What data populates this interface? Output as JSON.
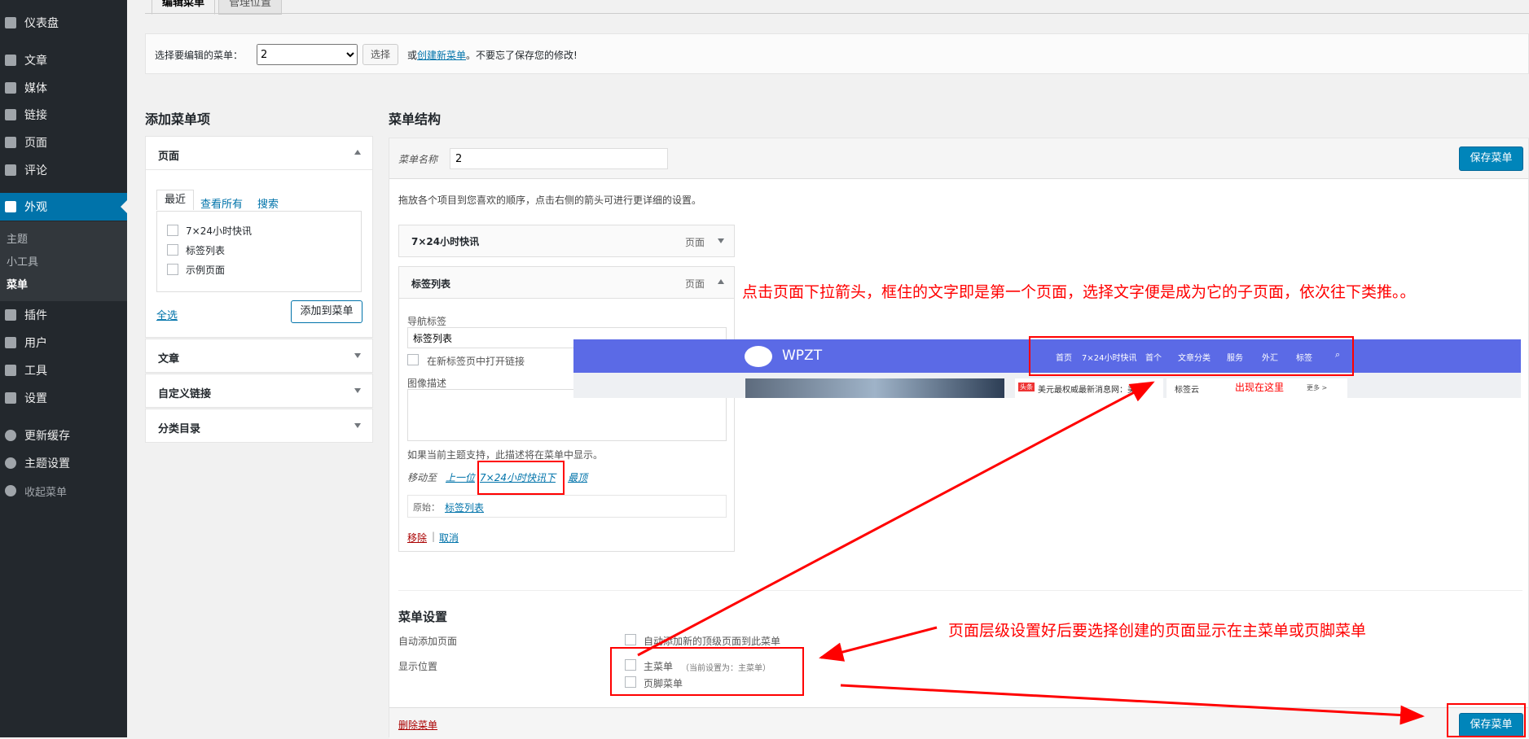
{
  "sidebar": {
    "items": [
      {
        "label": "仪表盘",
        "icon": "dashboard-icon"
      },
      {
        "label": "文章",
        "icon": "pin-icon"
      },
      {
        "label": "媒体",
        "icon": "media-icon"
      },
      {
        "label": "链接",
        "icon": "link-icon"
      },
      {
        "label": "页面",
        "icon": "page-icon"
      },
      {
        "label": "评论",
        "icon": "comment-icon"
      },
      {
        "label": "外观",
        "icon": "brush-icon"
      },
      {
        "label": "插件",
        "icon": "plugin-icon"
      },
      {
        "label": "用户",
        "icon": "user-icon"
      },
      {
        "label": "工具",
        "icon": "wrench-icon"
      },
      {
        "label": "设置",
        "icon": "settings-icon"
      },
      {
        "label": "更新缓存",
        "icon": "gear-icon"
      },
      {
        "label": "主题设置",
        "icon": "gear-icon"
      },
      {
        "label": "收起菜单",
        "icon": "collapse-icon"
      }
    ],
    "submenu": [
      "主题",
      "小工具",
      "菜单"
    ]
  },
  "tabs": {
    "edit": "编辑菜单",
    "manage": "管理位置"
  },
  "manage": {
    "select_label": "选择要编辑的菜单：",
    "select_value": "2",
    "select_button": "选择",
    "or_text": "或",
    "create_link": "创建新菜单",
    "reminder": "。不要忘了保存您的修改!"
  },
  "add_items": {
    "title": "添加菜单项",
    "pages_header": "页面",
    "tabs": [
      "最近",
      "查看所有",
      "搜索"
    ],
    "pages": [
      "7×24小时快讯",
      "标签列表",
      "示例页面"
    ],
    "select_all": "全选",
    "add_button": "添加到菜单",
    "sections": [
      "文章",
      "自定义链接",
      "分类目录"
    ]
  },
  "structure": {
    "title": "菜单结构",
    "name_label": "菜单名称",
    "name_value": "2",
    "save_button": "保存菜单",
    "instructions": "拖放各个项目到您喜欢的顺序，点击右侧的箭头可进行更详细的设置。",
    "items": [
      {
        "title": "7×24小时快讯",
        "type": "页面"
      },
      {
        "title": "标签列表",
        "type": "页面"
      }
    ],
    "edit": {
      "nav_label": "导航标签",
      "nav_value": "标签列表",
      "new_tab": "在新标签页中打开链接",
      "desc_label": "图像描述",
      "desc_hint": "如果当前主题支持，此描述将在菜单中显示。",
      "move_label": "移动至",
      "move_up": "上一位",
      "move_under": "7×24小时快讯下",
      "move_top": "最顶",
      "original_label": "原始：",
      "original_link": "标签列表",
      "remove": "移除",
      "sep": "|",
      "cancel": "取消"
    }
  },
  "settings": {
    "title": "菜单设置",
    "auto_label": "自动添加页面",
    "auto_option": "自动添加新的顶级页面到此菜单",
    "location_label": "显示位置",
    "main_menu": "主菜单",
    "main_menu_note": "（当前设置为：主菜单）",
    "footer_menu": "页脚菜单",
    "delete": "删除菜单",
    "save": "保存菜单"
  },
  "annotations": {
    "note1": "点击页面下拉箭头，框住的文字即是第一个页面，选择文字便是成为它的子页面，依次往下类推。。",
    "note2": "页面层级设置好后要选择创建的页面显示在主菜单或页脚菜单"
  },
  "preview": {
    "logo": "WPZT",
    "nav": [
      "首页",
      "7×24小时快讯",
      "首个",
      "文章分类",
      "服务",
      "外汇",
      "标签"
    ],
    "ticker_badge": "头条",
    "ticker_text": "美元最权威最新消息网：美...",
    "tags_label": "标签云",
    "tags_note": "出现在这里",
    "more": "更多 >"
  },
  "colors": {
    "sidebar": "#23282d",
    "active": "#0073aa",
    "primary": "#0085ba",
    "annotation": "#ff0000",
    "preview_nav": "#5b6ae6"
  }
}
